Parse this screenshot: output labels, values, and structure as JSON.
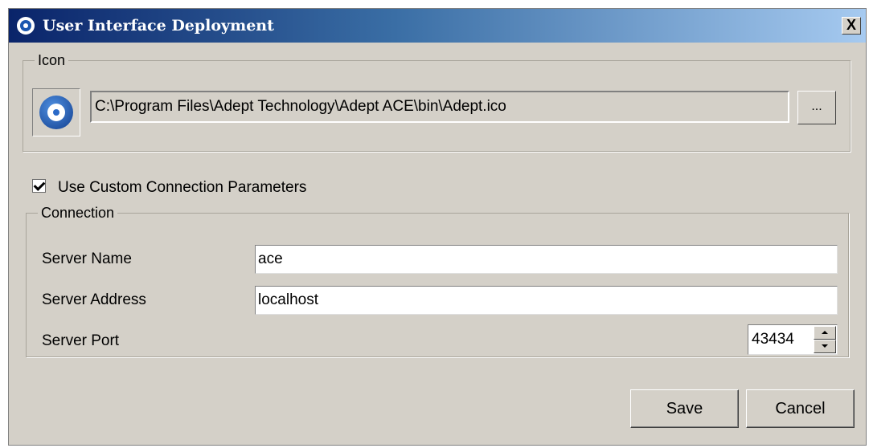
{
  "window": {
    "title": "User Interface Deployment",
    "close_label": "X"
  },
  "icon_section": {
    "legend": "Icon",
    "path": "C:\\Program Files\\Adept Technology\\Adept ACE\\bin\\Adept.ico",
    "browse_label": "..."
  },
  "custom_params": {
    "label": "Use Custom Connection Parameters",
    "checked": true
  },
  "connection": {
    "legend": "Connection",
    "server_name_label": "Server Name",
    "server_name_value": "ace",
    "server_address_label": "Server Address",
    "server_address_value": "localhost",
    "server_port_label": "Server Port",
    "server_port_value": "43434"
  },
  "buttons": {
    "save": "Save",
    "cancel": "Cancel"
  },
  "icons": {
    "title_icon": "adept-logo-icon",
    "preview_icon": "adept-logo-icon"
  }
}
